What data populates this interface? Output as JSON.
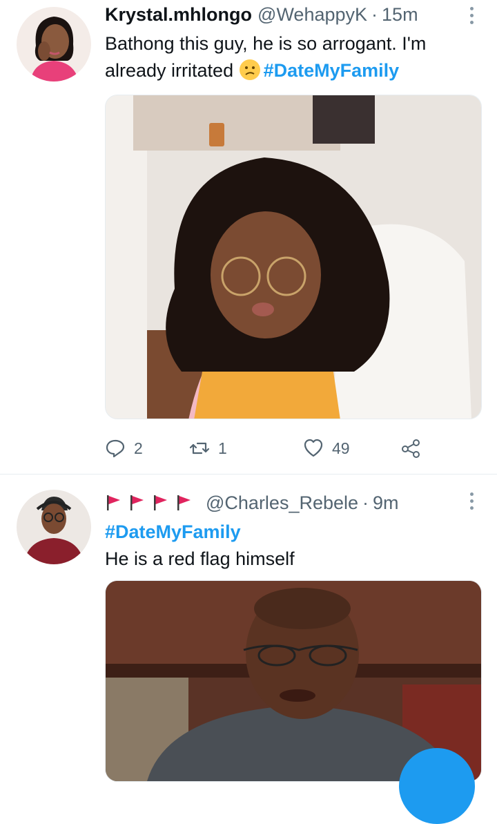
{
  "tweets": [
    {
      "display_name": "Krystal.mhlongo",
      "handle": "@WehappyK",
      "separator": "·",
      "time": "15m",
      "text_part1": "Bathong this guy, he is so arrogant. I'm already irritated ",
      "emoji": "confused-face-emoji",
      "hashtag": "#DateMyFamily",
      "actions": {
        "replies": "2",
        "retweets": "1",
        "likes": "49"
      }
    },
    {
      "flags": [
        "red-flag",
        "red-flag",
        "red-flag",
        "red-flag"
      ],
      "handle": "@Charles_Rebele",
      "separator": "·",
      "time": "9m",
      "hashtag": "#DateMyFamily",
      "text": "He is a red flag himself"
    }
  ],
  "colors": {
    "accent": "#1d9bf0",
    "secondary_text": "#536471",
    "flag_red": "#e0245e"
  },
  "icons": [
    "more-icon",
    "reply-icon",
    "retweet-icon",
    "like-icon",
    "share-icon",
    "compose-fab"
  ]
}
